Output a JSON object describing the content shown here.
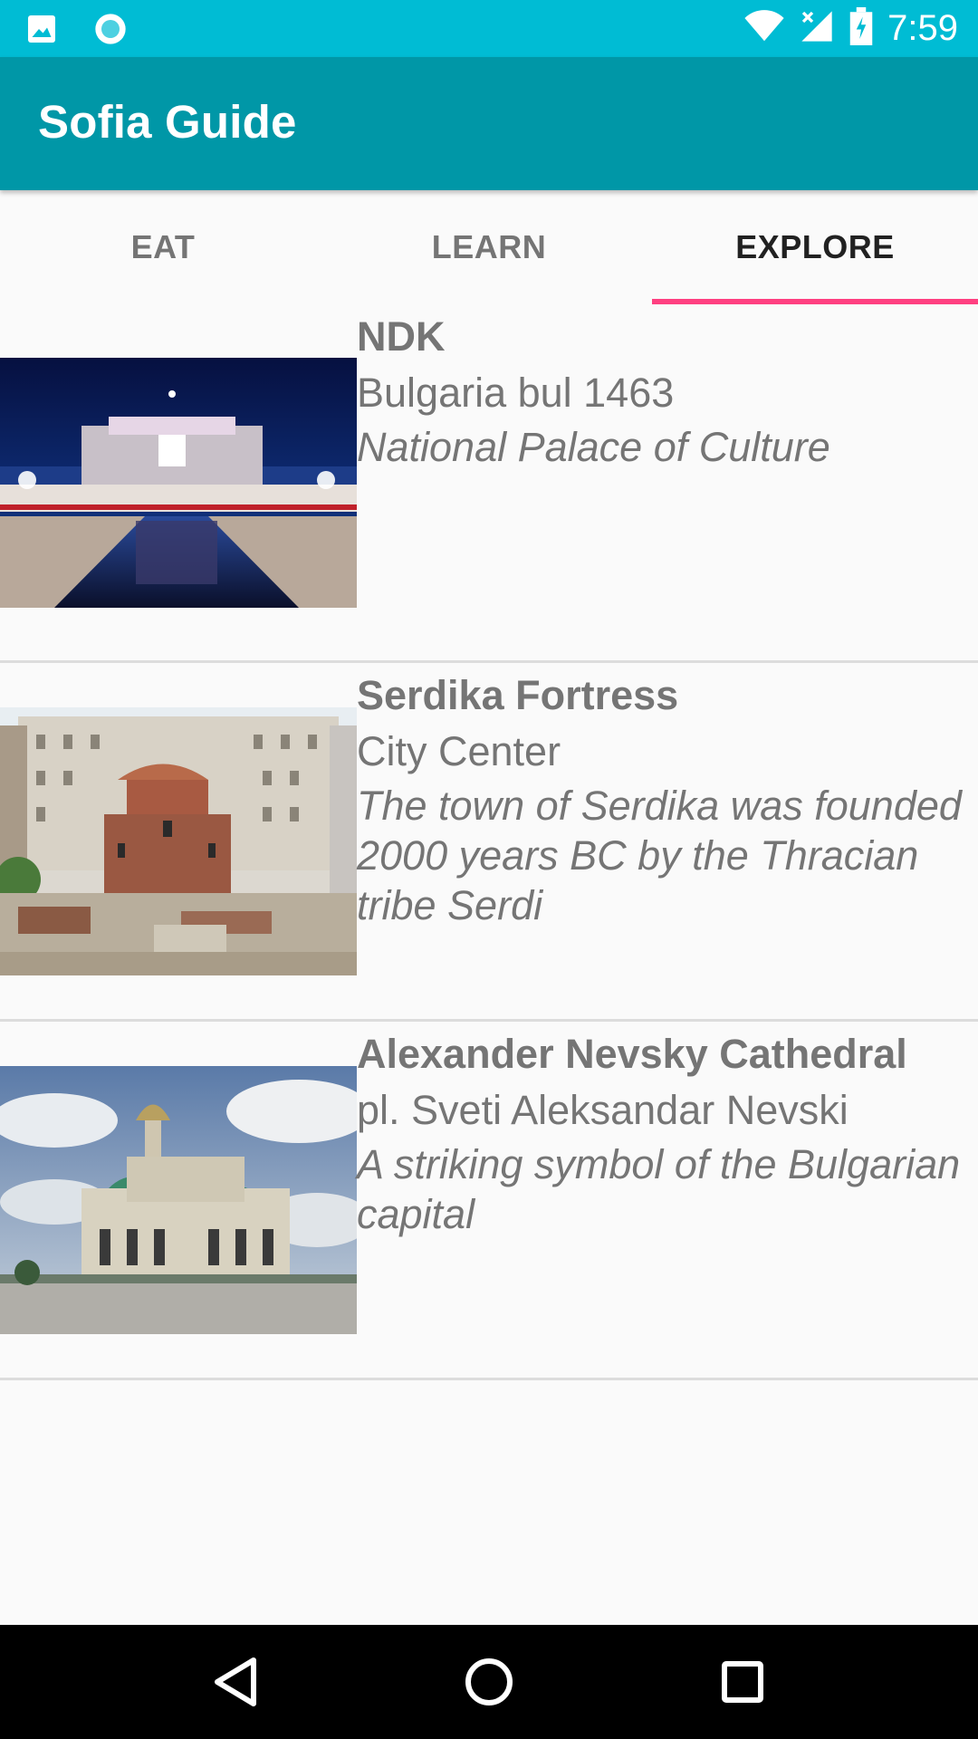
{
  "status_bar": {
    "time": "7:59",
    "left_icons": [
      "image-icon",
      "sync-icon"
    ],
    "right_icons": [
      "wifi-icon",
      "signal-icon",
      "battery-charging-icon"
    ]
  },
  "app_bar": {
    "title": "Sofia Guide"
  },
  "tabs": [
    {
      "label": "EAT",
      "active": false
    },
    {
      "label": "LEARN",
      "active": false
    },
    {
      "label": "EXPLORE",
      "active": true
    }
  ],
  "places": [
    {
      "name": "NDK",
      "address": "Bulgaria bul 1463",
      "description": "National Palace of Culture",
      "image": "ndk-photo"
    },
    {
      "name": "Serdika Fortress",
      "address": "City Center",
      "description": "The town of Serdika was founded 2000 years BC by the Thracian tribe Serdi",
      "image": "serdika-photo"
    },
    {
      "name": "Alexander Nevsky Cathedral",
      "address": "pl. Sveti Aleksandar Nevski",
      "description": "A striking symbol of the Bulgarian capital",
      "image": "cathedral-photo"
    }
  ],
  "nav_bar": {
    "buttons": [
      "back-icon",
      "home-icon",
      "recents-icon"
    ]
  },
  "colors": {
    "status_bar": "#00bcd4",
    "app_bar": "#0097a7",
    "tab_indicator": "#ff4081",
    "text_secondary": "#757575",
    "nav_bar": "#000000"
  }
}
